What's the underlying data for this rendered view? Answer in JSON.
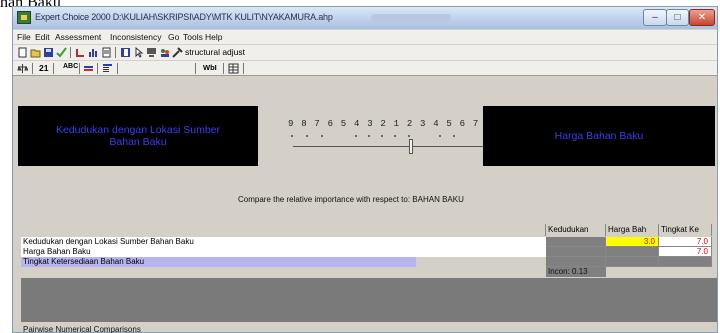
{
  "caption": "han Baku",
  "window": {
    "title": "Expert Choice 2000     D:\\KULIAH\\SKRIPSI\\ADY\\MTK KULIT\\NYAKAMURA.ahp"
  },
  "menu": [
    "File",
    "Edit",
    "Assessment",
    "Inconsistency",
    "Go",
    "Tools",
    "Help"
  ],
  "toolbar": {
    "structural_adjust_label": "structural adjust",
    "text_21": "21",
    "text_abc": "ABC",
    "text_wbl": "WbI"
  },
  "panels": {
    "left_text": "Kedudukan dengan Lokasi Sumber Bahan Baku",
    "right_text": "Harga Bahan Baku"
  },
  "scale": {
    "numbers": "9 8 7 6 5 4 3 2 1 2 3 4 5 6 7 8 9",
    "thumb_value": 3
  },
  "compare_text": "Compare the relative importance  with respect to: BAHAN BAKU",
  "grid": {
    "headers": [
      "Kedudukan",
      "Harga Bah",
      "Tingkat Ke"
    ],
    "rows": [
      {
        "label": "Kedudukan dengan Lokasi Sumber Bahan Baku",
        "cells": [
          "",
          "3.0",
          "7.0"
        ]
      },
      {
        "label": "Harga Bahan Baku",
        "cells": [
          "",
          "",
          "7.0"
        ]
      },
      {
        "label": "Tingkat Ketersediaan Bahan Baku",
        "cells": [
          "",
          "",
          ""
        ]
      }
    ],
    "incon": "Incon: 0.13"
  },
  "bottom_label": "Pairwise Numerical Comparisons",
  "colors": {
    "panel_text": "#3c3cf0",
    "highlight_yellow": "#ffff00",
    "value_red": "#e00000",
    "row_highlight": "#b8b4f0"
  }
}
